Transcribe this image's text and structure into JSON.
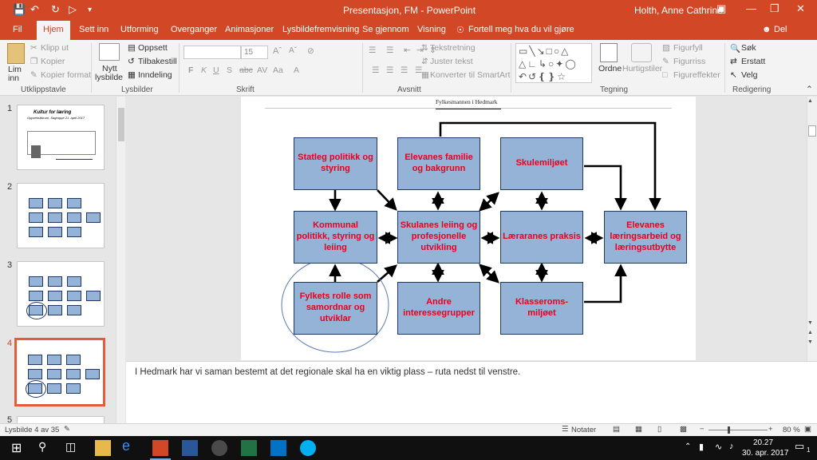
{
  "titlebar": {
    "title": "Presentasjon, FM  -  PowerPoint",
    "user": "Holth, Anne Cathrine"
  },
  "tabs": [
    "Fil",
    "Hjem",
    "Sett inn",
    "Utforming",
    "Overganger",
    "Animasjoner",
    "Lysbildefremvisning",
    "Se gjennom",
    "Visning",
    "Fortell meg hva du vil gjøre",
    "Del"
  ],
  "ribbon": {
    "paste": [
      "Lim",
      "inn"
    ],
    "cut": "Klipp ut",
    "copy": "Kopier",
    "format_painter": "Kopier format",
    "new_slide": [
      "Nytt",
      "lysbilde"
    ],
    "layout": "Oppsett",
    "reset": "Tilbakestill",
    "section": "Inndeling",
    "font_size": "15",
    "text_direction": "Tekstretning",
    "align_text": "Juster tekst",
    "convert_smartart": "Konverter til SmartArt",
    "arrange": "Ordne",
    "quick_styles": "Hurtigstiler",
    "shape_fill": "Figurfyll",
    "shape_outline": "Figurriss",
    "shape_effects": "Figureffekter",
    "find": "Søk",
    "replace": "Erstatt",
    "select": "Velg",
    "groups": [
      "Utklippstavle",
      "Lysbilder",
      "Skrift",
      "Avsnitt",
      "Tegning",
      "Redigering"
    ]
  },
  "thumbnails": {
    "numbers": [
      "1",
      "2",
      "3",
      "4",
      "5"
    ],
    "slide1_title": "Kultur for læring",
    "slide1_subtitle": "Oppvekstforum, Sagruppe 21. april 2017"
  },
  "slide": {
    "header": "Fylkesmannen i Hedmark",
    "boxes": {
      "statleg": "Statleg politikk og styring",
      "familie": "Elevanes familie og bakgrunn",
      "skulemiljo": "Skulemiljøet",
      "kommunal": "Kommunal politikk, styring og leiing",
      "leiing": "Skulanes leiing og profesjonelle utvikling",
      "praksis": "Læraranes praksis",
      "laering": "Elevanes læringsarbeid og læringsutbytte",
      "fylket": "Fylkets rolle som samordnar og utviklar",
      "andre": "Andre interessegrupper",
      "klasserom": "Klasseroms-miljøet"
    }
  },
  "notes": "I Hedmark har vi saman bestemt at det regionale skal ha en viktig plass – ruta nedst til venstre.",
  "status": {
    "slide_count": "Lysbilde 4 av 35",
    "notes_btn": "Notater",
    "zoom": "80 %"
  },
  "taskbar": {
    "time": "20.27",
    "date": "30. apr. 2017",
    "notification_count": "1"
  },
  "colors": {
    "accent": "#d24726",
    "box_fill": "#95b3d7",
    "box_text": "#e8001c"
  }
}
